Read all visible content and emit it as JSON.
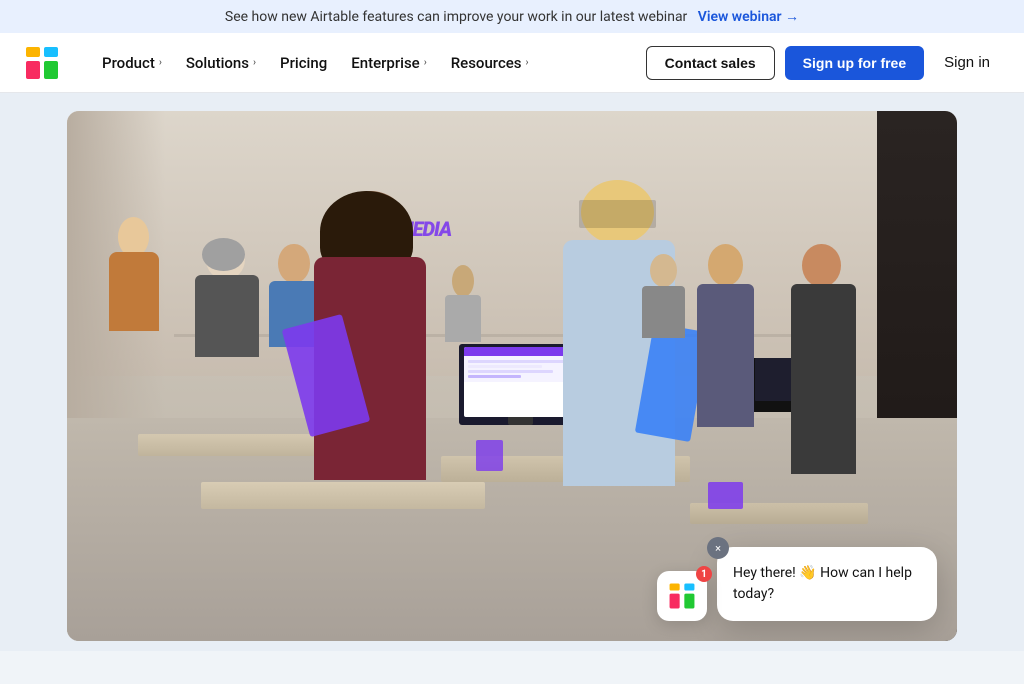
{
  "banner": {
    "text": "See how new Airtable features can improve your work in our latest webinar",
    "link_text": "View webinar →",
    "link_url": "#"
  },
  "nav": {
    "logo_alt": "Airtable",
    "items": [
      {
        "label": "Product",
        "has_dropdown": true
      },
      {
        "label": "Solutions",
        "has_dropdown": true
      },
      {
        "label": "Pricing",
        "has_dropdown": false
      },
      {
        "label": "Enterprise",
        "has_dropdown": true
      },
      {
        "label": "Resources",
        "has_dropdown": true
      }
    ],
    "contact_sales_label": "Contact sales",
    "signup_label": "Sign up for free",
    "signin_label": "Sign in"
  },
  "chat": {
    "message": "Hey there! 👋 How can I help today?",
    "close_label": "×"
  },
  "fab": {
    "badge_count": "1"
  }
}
